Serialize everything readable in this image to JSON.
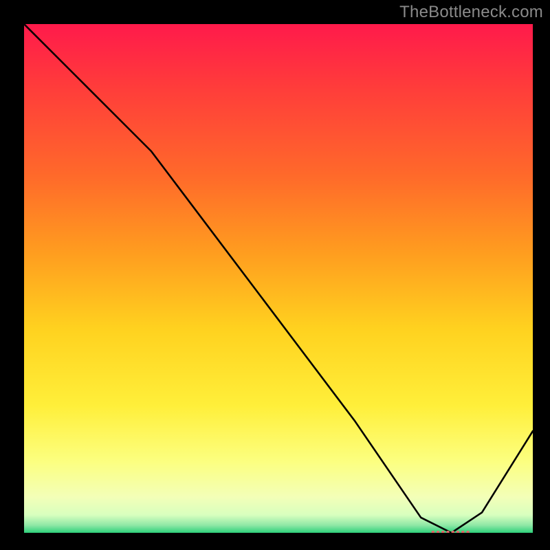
{
  "watermark": "TheBottleneck.com",
  "chart_data": {
    "type": "line",
    "title": "",
    "xlabel": "",
    "ylabel": "",
    "xlim": [
      0,
      100
    ],
    "ylim": [
      0,
      100
    ],
    "x": [
      0,
      10,
      20,
      25,
      65,
      78,
      84,
      90,
      100
    ],
    "values": [
      100,
      90,
      80,
      75,
      22,
      3,
      0,
      4,
      20
    ],
    "annotations": [
      {
        "label": "minimum-marker",
        "x": 84,
        "y": 0
      }
    ],
    "gradient_stops": [
      {
        "offset": 0.0,
        "color": "#ff1a4b"
      },
      {
        "offset": 0.12,
        "color": "#ff3b3b"
      },
      {
        "offset": 0.3,
        "color": "#ff6a2a"
      },
      {
        "offset": 0.45,
        "color": "#ff9d1f"
      },
      {
        "offset": 0.6,
        "color": "#ffd21f"
      },
      {
        "offset": 0.75,
        "color": "#ffef3a"
      },
      {
        "offset": 0.86,
        "color": "#fcff80"
      },
      {
        "offset": 0.93,
        "color": "#f3ffb8"
      },
      {
        "offset": 0.965,
        "color": "#d8ffbe"
      },
      {
        "offset": 0.985,
        "color": "#8fe8a6"
      },
      {
        "offset": 1.0,
        "color": "#2dd07a"
      }
    ],
    "marker_color": "#e06666"
  }
}
